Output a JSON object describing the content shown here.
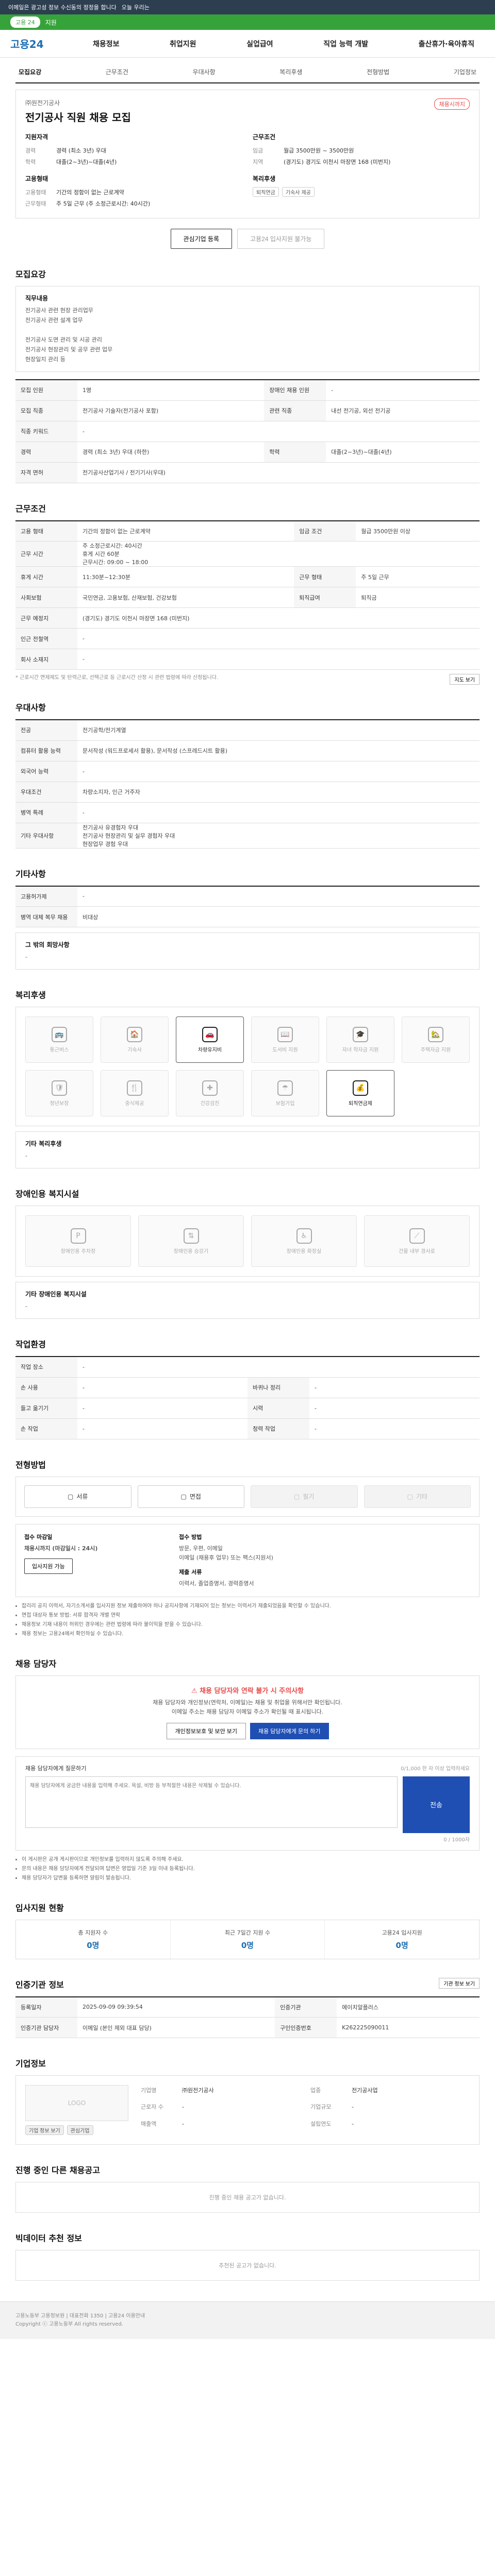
{
  "topbar": {
    "text": "이메일은 광고성 정보 수신동의 정정을 합니다",
    "sub": "오늘 우리는"
  },
  "greenbar": {
    "pill": "고용 24",
    "text": "지원"
  },
  "gnb": {
    "logo": "고용24",
    "menu": [
      "채용정보",
      "취업지원",
      "실업급여",
      "직업 능력 개발",
      "출산휴가·육아휴직"
    ]
  },
  "tabs": [
    "모집요강",
    "근무조건",
    "우대사항",
    "복리후생",
    "전형방법",
    "기업정보"
  ],
  "head": {
    "company": "㈜원전기공사",
    "title": "전기공사 직원 채용 모집",
    "badge": "채용시까지",
    "left_title": "지원자격",
    "left_rows": [
      {
        "k": "경력",
        "v": "경력 (최소 3년) 우대"
      },
      {
        "k": "학력",
        "v": "대졸(2~3년)~대졸(4년)"
      }
    ],
    "left_title2": "고용형태",
    "left_rows2": [
      {
        "k": "고용형태",
        "v": "기간의 정함이 없는 근로계약"
      },
      {
        "k": "근무형태",
        "v": "주 5일 근무 (주 소정근로시간: 40시간)"
      }
    ],
    "right_title": "근무조건",
    "right_rows": [
      {
        "k": "임금",
        "v": "월급 3500만원 ~ 3500만원"
      },
      {
        "k": "지역",
        "v": "(경기도) 경기도 이천시 마장면 168 (미번지)"
      }
    ],
    "right_title2": "복리후생",
    "tags": [
      "퇴직연금",
      "기숙사 제공"
    ]
  },
  "actions": {
    "interest": "관심기업 등록",
    "apply": "고용24 입사지원 불가능"
  },
  "recruit": {
    "title": "모집요강",
    "job_head": "직무내용",
    "job_text": "전기공사 관련 현장 관리업무\n전기공사 관련 설계 업무\n\n전기공사 도면 관리 및 시공 관리\n전기공사 현장관리 및 공무 관련 업무\n현장일지 관리 등",
    "rows": [
      {
        "k1": "모집 인원",
        "v1": "1명",
        "k2": "장애인 채용 인원",
        "v2": "-"
      },
      {
        "k1": "모집 직종",
        "v1": "전기공사 기술자(전기공사 포함)",
        "k2": "관련 직종",
        "v2": "내선 전기공, 외선 전기공"
      },
      {
        "k1": "직종 키워드",
        "v1": "-",
        "k2": "",
        "v2": ""
      },
      {
        "k1": "경력",
        "v1": "경력 (최소 3년) 우대 (하한)",
        "k2": "학력",
        "v2": "대졸(2~3년)~대졸(4년)"
      },
      {
        "k1": "자격 면허",
        "v1": "전기공사산업기사 / 전기기사(우대)",
        "k2": "",
        "v2": ""
      }
    ]
  },
  "work": {
    "title": "근무조건",
    "rows": [
      {
        "k1": "고용 형태",
        "v1": "기간의 정함이 없는 근로계약",
        "k2": "임금 조건",
        "v2": "월급 3500만원 이상"
      },
      {
        "k1": "근무 시간",
        "v1": "주 소정근로시간: 40시간\n휴게 시간 60분\n근무시간: 09:00 ~ 18:00",
        "k2": "",
        "v2": ""
      },
      {
        "k1": "휴게 시간",
        "v1": "11:30분~12:30분",
        "k2": "근무 형태",
        "v2": "주 5일 근무"
      },
      {
        "k1": "사회보험",
        "v1": "국민연금, 고용보험, 산재보험, 건강보험",
        "k2": "퇴직급여",
        "v2": "퇴직금"
      },
      {
        "k1": "근무 예정지",
        "v1": "(경기도) 경기도 이천시 마장면 168 (미번지)",
        "k2": "",
        "v2": ""
      },
      {
        "k1": "인근 전철역",
        "v1": "-",
        "k2": "",
        "v2": ""
      },
      {
        "k1": "회사 소재지",
        "v1": "-",
        "k2": "",
        "v2": ""
      }
    ],
    "map_btn": "지도 보기",
    "note": "* 근로시간 면제제도 및 탄력근로, 선택근로 등 근로시간 산정 시 관련 법령에 따라 산정됩니다."
  },
  "pref": {
    "title": "우대사항",
    "rows": [
      {
        "k": "전공",
        "v": "전기공학/전기계열"
      },
      {
        "k": "컴퓨터 활용 능력",
        "v": "문서작성 (워드프로세서 활용), 문서작성 (스프레드시트 활용)"
      },
      {
        "k": "외국어 능력",
        "v": "-"
      },
      {
        "k": "우대조건",
        "v": "차량소지자, 인근 거주자"
      },
      {
        "k": "병역 특례",
        "v": "-"
      },
      {
        "k": "기타 우대사항",
        "v": "전기공사 유경험자 우대\n전기공사 현장관리 및 실무 경험자 우대\n현장업무 경험 우대"
      }
    ]
  },
  "etc": {
    "title": "기타사항",
    "rows": [
      {
        "k": "고용허가제",
        "v": "-"
      },
      {
        "k": "병역 대체 복무 채용",
        "v": "비대상"
      }
    ],
    "extra_head": "그 밖의 회망사항",
    "extra_text": "-"
  },
  "welfare": {
    "title": "복리후생",
    "items": [
      {
        "label": "통근버스",
        "on": false,
        "icon": "bus-icon",
        "glyph": "🚌"
      },
      {
        "label": "기숙사",
        "on": false,
        "icon": "dorm-icon",
        "glyph": "🏠"
      },
      {
        "label": "차량유지비",
        "on": true,
        "icon": "car-icon",
        "glyph": "🚗"
      },
      {
        "label": "도서비 지원",
        "on": false,
        "icon": "book-icon",
        "glyph": "📖"
      },
      {
        "label": "자녀 학자금 지원",
        "on": false,
        "icon": "cap-icon",
        "glyph": "🎓"
      },
      {
        "label": "주택자금 지원",
        "on": false,
        "icon": "house-icon",
        "glyph": "🏡"
      },
      {
        "label": "정년보장",
        "on": false,
        "icon": "shield-icon",
        "glyph": "🛡"
      },
      {
        "label": "중식제공",
        "on": false,
        "icon": "meal-icon",
        "glyph": "🍴"
      },
      {
        "label": "건강검진",
        "on": false,
        "icon": "health-icon",
        "glyph": "✚"
      },
      {
        "label": "보험가입",
        "on": false,
        "icon": "insure-icon",
        "glyph": "☂"
      },
      {
        "label": "퇴직연금제",
        "on": true,
        "icon": "pension-icon",
        "glyph": "💰"
      }
    ],
    "etc_head": "기타 복리후생",
    "etc_text": "-"
  },
  "disability": {
    "title": "장애인용 복지시설",
    "items": [
      {
        "label": "장애인용 주차장",
        "icon": "parking-icon",
        "glyph": "P"
      },
      {
        "label": "장애인용 승강기",
        "icon": "elevator-icon",
        "glyph": "⇅"
      },
      {
        "label": "장애인용 화장실",
        "icon": "toilet-icon",
        "glyph": "♿"
      },
      {
        "label": "건물 내부 경사로",
        "icon": "ramp-icon",
        "glyph": "⟋"
      }
    ],
    "etc_head": "기타 장애인용 복지시설",
    "etc_text": "-"
  },
  "env": {
    "title": "작업환경",
    "rows": [
      {
        "k1": "작업 장소",
        "v1": "-",
        "k2": "",
        "v2": ""
      },
      {
        "k1": "손 사용",
        "v1": "-",
        "k2": "바퀴나 정리",
        "v2": "-"
      },
      {
        "k1": "들고 옮기기",
        "v1": "-",
        "k2": "시력",
        "v2": "-"
      },
      {
        "k1": "손 작업",
        "v1": "-",
        "k2": "청력 작업",
        "v2": "-"
      }
    ]
  },
  "method": {
    "title": "전형방법",
    "items": [
      {
        "label": "서류",
        "on": true,
        "icon": "document-icon"
      },
      {
        "label": "면접",
        "on": true,
        "icon": "interview-icon"
      },
      {
        "label": "필기",
        "on": false,
        "icon": "pen-icon"
      },
      {
        "label": "기타",
        "on": false,
        "icon": "etc-icon"
      }
    ]
  },
  "apply": {
    "l_head": "접수 마감일",
    "l_val": "채용시까지 (마감일시 : 24시)",
    "l_btn": "입사지원 가능",
    "r_head": "접수 방법",
    "r_val": "방문, 우편, 이메일",
    "r_val2": "이메일 (채용후 업무) 또는 팩스(지원서)",
    "r_head2": "제출 서류",
    "r_val3": "이력서, 졸업증명서, 경력증명서",
    "bullets": [
      "잡리리 공지 이력서, 자기소개서를 입사지원 정보 제출하여야 하나 공지사항에 기재되어 있는 정보는 이력서가 제출되었음을 확인할 수 있습니다.",
      "면접 대상자 통보 방법: 서류 합격자 개별 연락",
      "채용정보 기재 내용이 허위인 경우에는 관련 법령에 따라 불이익을 받을 수 있습니다.",
      "채용 정보는 고용24에서 확인하실 수 있습니다."
    ]
  },
  "contact": {
    "title": "채용 담당자",
    "warn": "채용 담당자와 연락 불가 시 주의사항",
    "sub": "채용 담당자와 개인정보(연락처, 이메일)는 채용 및 취업을 위해서만 확인됩니다.\n이메일 주소는 채용 담당자 이메일 주소가 확인될 때 표시됩니다.",
    "b1": "개인정보보호 및 보안 보기",
    "b2": "채용 담당자에게 문의 하기",
    "qa_head": "채용 담당자에게 질문하기",
    "qa_right": "0/1,000 한 자 이상 입력하세요",
    "qa_placeholder": "채용 담당자에게 궁금한 내용을 입력해 주세요. 욕설, 비방 등 부적절한 내용은 삭제될 수 있습니다.",
    "qa_btn": "전송",
    "qa_count": "0 / 1000자",
    "notes": [
      "이 게시판은 공개 게시판이므로 개인정보를 입력하지 않도록 주의해 주세요.",
      "문의 내용은 채용 담당자에게 전달되며 답변은 영업일 기준 3일 이내 등록됩니다.",
      "채용 담당자가 답변을 등록하면 알림이 발송됩니다."
    ]
  },
  "stats": {
    "title": "입사지원 현황",
    "items": [
      {
        "label": "총 지원자 수",
        "value": "0명"
      },
      {
        "label": "최근 7일간 지원 수",
        "value": "0명"
      },
      {
        "label": "고용24 입사지원",
        "value": "0명"
      }
    ]
  },
  "info": {
    "title": "인증기관 정보",
    "btn": "기관 정보 보기",
    "rows": [
      {
        "k1": "등록일자",
        "v1": "2025-09-09 09:39:54",
        "k2": "인증기관",
        "v2": "에이치알플러스"
      },
      {
        "k1": "인증기관 담당자",
        "v1": "이메일 (본인 제외 대표 담당)",
        "k2": "구인인증번호",
        "v2": "K262225090011"
      }
    ]
  },
  "corp": {
    "title": "기업정보",
    "logo": "LOGO",
    "b1": "기업 정보 보기",
    "b2": "관심기업",
    "rows": [
      {
        "k": "기업명",
        "v": "㈜원전기공사"
      },
      {
        "k": "업종",
        "v": "전기공사업"
      },
      {
        "k": "근로자 수",
        "v": "-"
      },
      {
        "k": "기업규모",
        "v": "-"
      },
      {
        "k": "매출액",
        "v": "-"
      },
      {
        "k": "설립연도",
        "v": "-"
      }
    ]
  },
  "others": {
    "title": "진행 중인 다른 채용공고",
    "empty": "진행 중인 채용 공고가 없습니다."
  },
  "similar": {
    "title": "빅데이터 추천 정보",
    "empty": "추천된 공고가 없습니다."
  },
  "footer": {
    "line1": "고용노동부 고용정보원 | 대표전화 1350 | 고용24 이용안내",
    "line2": "Copyright ⓒ 고용노동부 All rights reserved."
  }
}
